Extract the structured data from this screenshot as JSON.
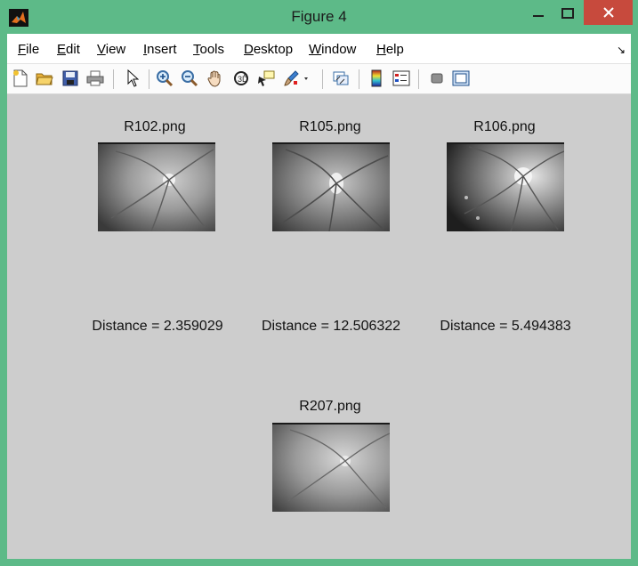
{
  "window": {
    "title": "Figure 4"
  },
  "menu": [
    "File",
    "Edit",
    "View",
    "Insert",
    "Tools",
    "Desktop",
    "Window",
    "Help"
  ],
  "menu_underlines": [
    "F",
    "E",
    "V",
    "I",
    "T",
    "D",
    "W",
    "H"
  ],
  "toolbar": {
    "icons": [
      "new-figure-icon",
      "open-file-icon",
      "save-icon",
      "print-icon",
      "pointer-icon",
      "zoom-in-icon",
      "zoom-out-icon",
      "pan-hand-icon",
      "rotate-3d-icon",
      "data-cursor-icon",
      "brush-icon",
      "link-plot-icon",
      "colorbar-icon",
      "legend-icon",
      "hide-plot-tools-icon",
      "show-plot-tools-icon"
    ]
  },
  "images": [
    {
      "title": "R102.png",
      "distance": "Distance = 2.359029"
    },
    {
      "title": "R105.png",
      "distance": "Distance = 12.506322"
    },
    {
      "title": "R106.png",
      "distance": "Distance = 5.494383"
    },
    {
      "title": "R207.png",
      "distance": ""
    }
  ],
  "colors": {
    "titlebar": "#5dba88",
    "close_button": "#c74a3d",
    "figure_bg": "#cdcdcd"
  }
}
